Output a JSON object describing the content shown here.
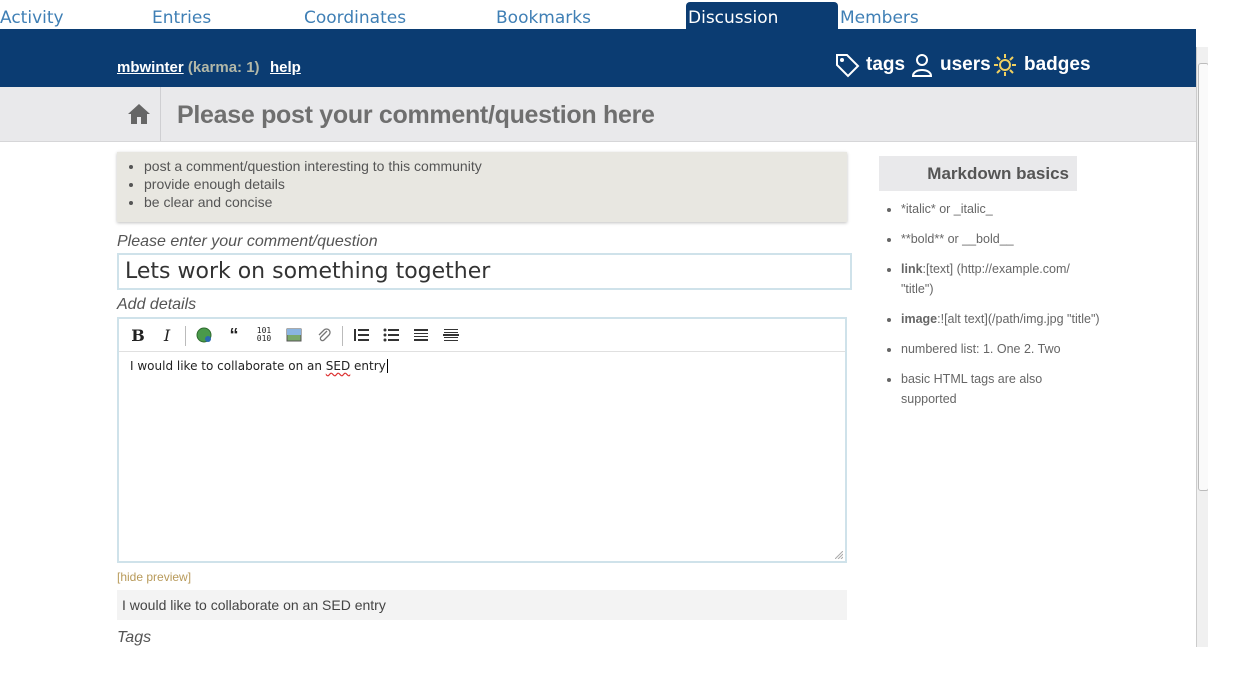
{
  "tabs": [
    {
      "label": "Activity"
    },
    {
      "label": "Entries"
    },
    {
      "label": "Coordinates"
    },
    {
      "label": "Bookmarks"
    },
    {
      "label": "Discussion"
    },
    {
      "label": "Members"
    }
  ],
  "header": {
    "username": "mbwinter",
    "karma": "(karma: 1)",
    "help": "help",
    "nav": {
      "tags": "tags",
      "users": "users",
      "badges": "badges"
    }
  },
  "page_title": "Please post your comment/question here",
  "tips": [
    "post a comment/question interesting to this community",
    "provide enough details",
    "be clear and concise"
  ],
  "form": {
    "title_label": "Please enter your comment/question",
    "title_value": "Lets work on something together",
    "details_label": "Add details",
    "body_pre": "I would like to collaborate on an ",
    "body_sq": "SED",
    "body_post": " entry",
    "hide_preview": "[hide preview]",
    "preview_text": "I would like to collaborate on an SED entry",
    "tags_label": "Tags"
  },
  "markdown": {
    "title": "Markdown basics",
    "items": {
      "italic": "*italic* or _italic_",
      "bold": "**bold** or __bold__",
      "link_label": "link",
      "link_text": ":[text] (http://example.com/ \"title\")",
      "image_label": "image",
      "image_text": ":![alt text](/path/img.jpg \"title\")",
      "numbered": "numbered list: 1. One 2. Two",
      "html": "basic HTML tags are also supported"
    }
  },
  "colors": {
    "header": "#0b3c72",
    "tab_link": "#3f7fb5",
    "subbar": "#e9e9eb"
  }
}
